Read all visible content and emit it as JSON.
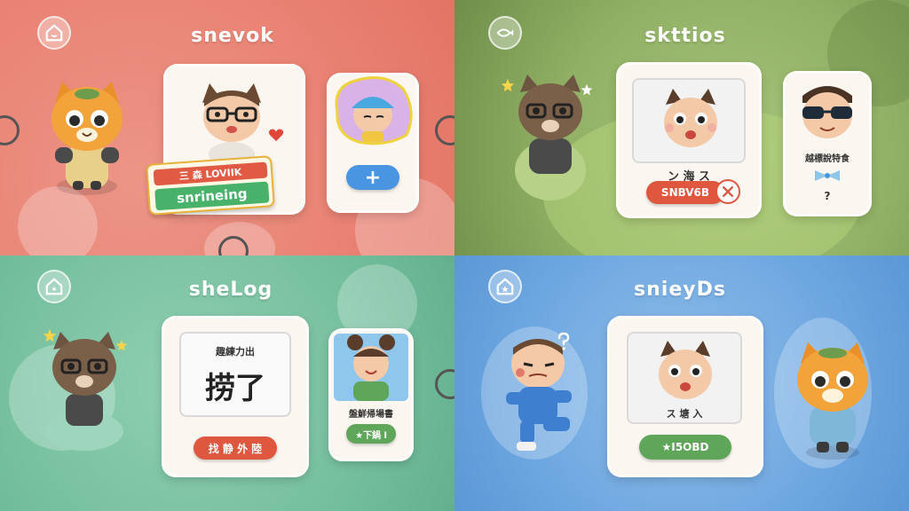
{
  "panels": [
    {
      "title": "snevok",
      "icon": "house-icon",
      "cards": {
        "banner_top": "三 森 LOVIIK",
        "banner_bottom": "snrineing",
        "button_symbol": "+"
      }
    },
    {
      "title": "skttios",
      "icon": "fish-icon",
      "cards": {
        "caption": "ン 海 ス",
        "pill_label": "SNBV6B",
        "right_caption": "越標說特食",
        "right_mark": "?"
      }
    },
    {
      "title": "sheLog",
      "icon": "house-icon",
      "cards": {
        "heading": "趣練力出",
        "big_text": "捞了",
        "pill_label": "找 静 外 陸",
        "right_caption": "盤鮮帰場書",
        "right_pill": "★下鍋 l"
      }
    },
    {
      "title": "snieyDs",
      "icon": "star-house-icon",
      "cards": {
        "caption": "ス 塘 入",
        "pill_label": "★I5OBD"
      }
    }
  ],
  "colors": {
    "red_panel": "#e98274",
    "green_panel": "#90b064",
    "mint_panel": "#76c09f",
    "blue_panel": "#6fa8e1",
    "orange_cat": "#f2a33a",
    "accent_red": "#e0573f",
    "accent_green": "#5fa65a",
    "accent_blue": "#3f8fe0"
  }
}
